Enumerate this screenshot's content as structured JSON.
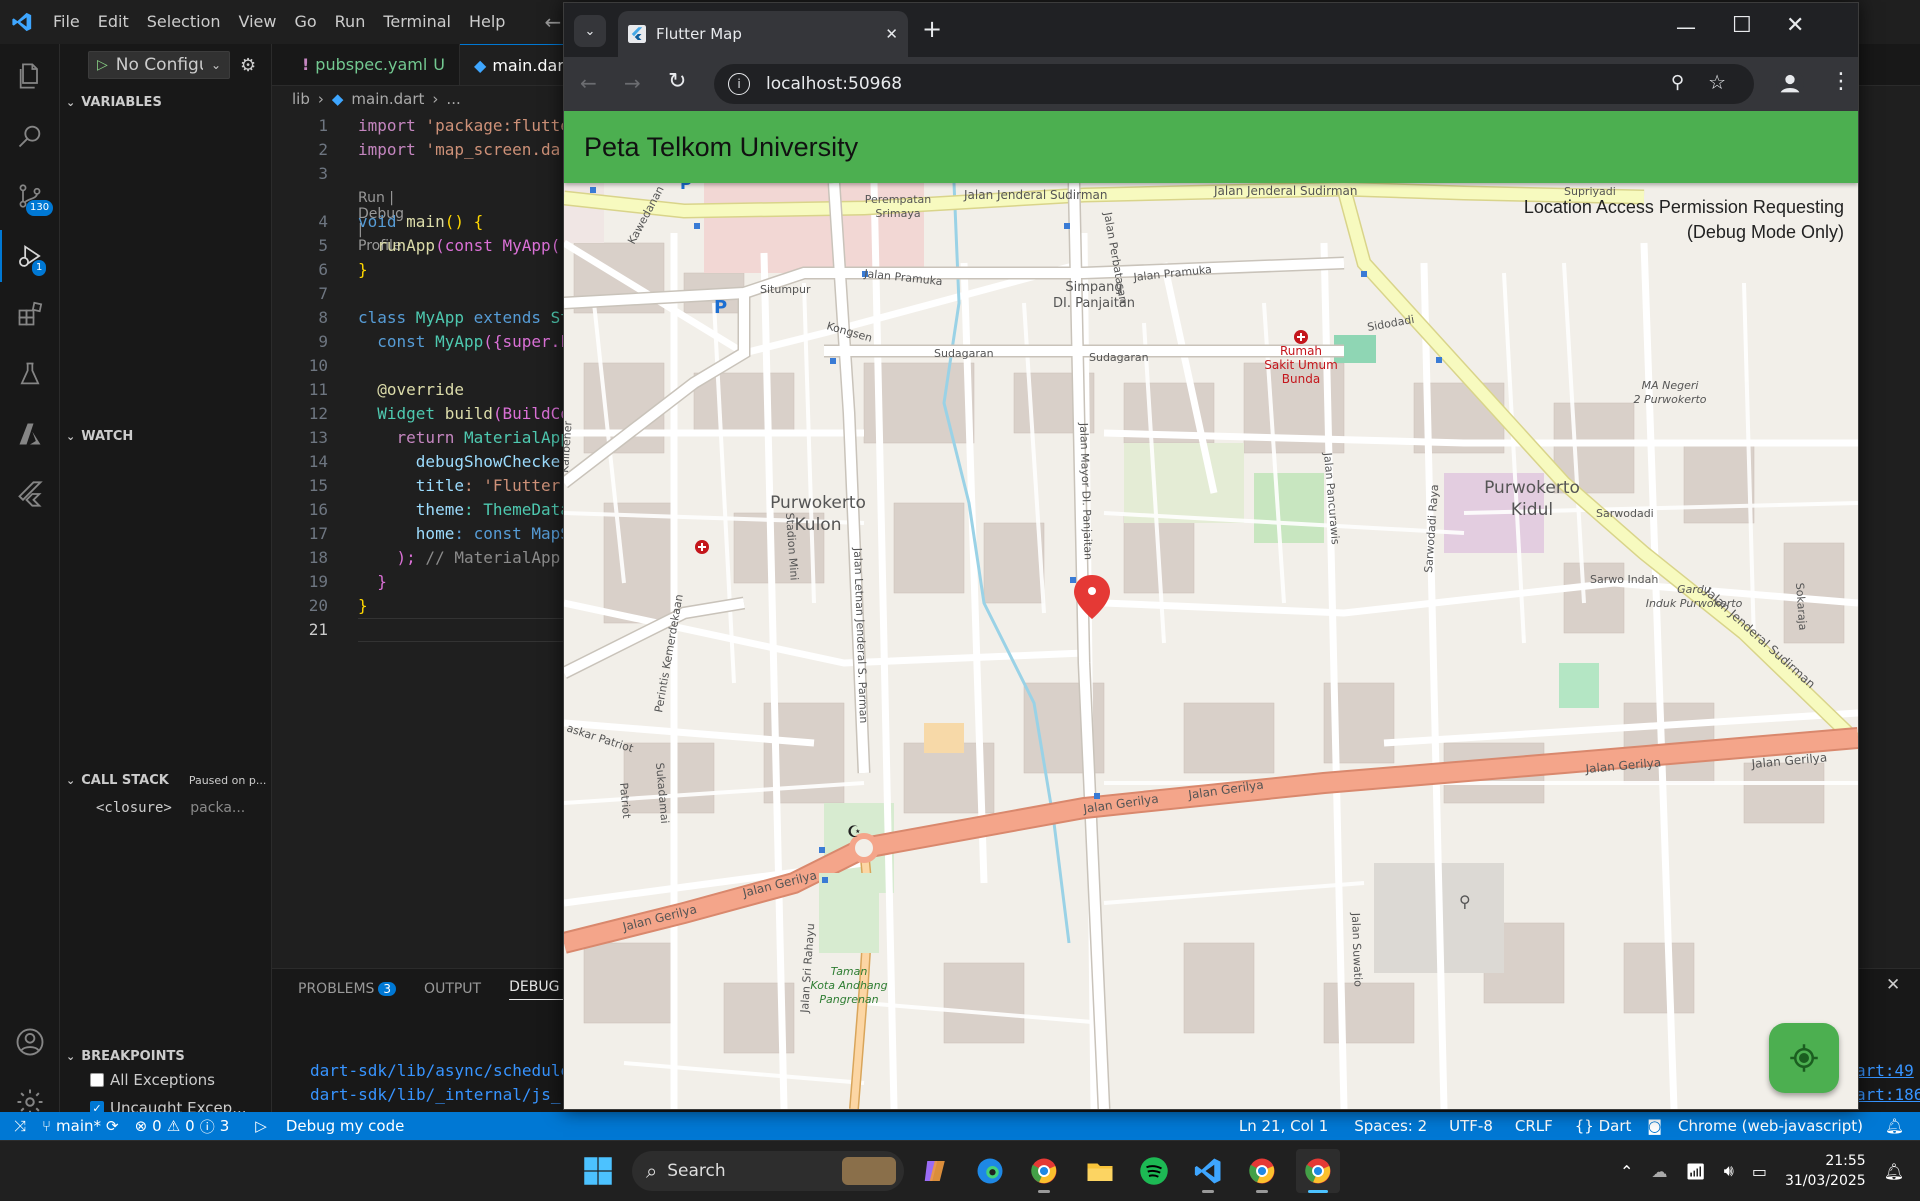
{
  "vscode": {
    "menu": [
      "File",
      "Edit",
      "Selection",
      "View",
      "Go",
      "Run",
      "Terminal",
      "Help"
    ],
    "activity_badges": {
      "source_control": "130",
      "run_debug": "1"
    },
    "run_config": "No Configu",
    "sections": {
      "variables": "VARIABLES",
      "watch": "WATCH",
      "call_stack": "CALL STACK",
      "call_stack_status": "Paused on p...",
      "breakpoints": "BREAKPOINTS"
    },
    "call_stack_frame": {
      "name": "<closure>",
      "source": "packa..."
    },
    "breakpoints": [
      {
        "label": "All Exceptions",
        "checked": false
      },
      {
        "label": "Uncaught Excep...",
        "checked": true
      }
    ],
    "tabs": [
      {
        "prefix": "!",
        "label": "pubspec.yaml",
        "suffix": "U"
      },
      {
        "prefix": "",
        "label": "main.dart",
        "suffix": ""
      }
    ],
    "breadcrumb": [
      "lib",
      "main.dart",
      "..."
    ],
    "codelens": "Run | Debug | Profile",
    "line_numbers": [
      "1",
      "2",
      "3",
      "4",
      "5",
      "6",
      "7",
      "8",
      "9",
      "10",
      "11",
      "12",
      "13",
      "14",
      "15",
      "16",
      "17",
      "18",
      "19",
      "20",
      "21"
    ],
    "code_text": {
      "l1_kw": "import",
      "l1_str": " 'package:flutte",
      "l2_kw": "import",
      "l2_str": " 'map_screen.dar",
      "l4_kw": "void",
      "l4_fn": " main",
      "l4_rest": "() {",
      "l5_fn": "runApp",
      "l5_rest": "(const MyApp(",
      "l6": "}",
      "l8_kw": "class",
      "l8_cls": " MyApp",
      "l8_kw2": " extends",
      "l8_rest": " St",
      "l9_kw": "const",
      "l9_cls": " MyApp",
      "l9_rest": "({super.k",
      "l11": "@override",
      "l12_cls": "Widget",
      "l12_fn": " build",
      "l12_rest": "(BuildCo",
      "l13_kw": "return",
      "l13_cls": " MaterialApp",
      "l14": "debugShowChecke",
      "l15_pr": "title",
      "l15_str": ": 'Flutter",
      "l16_pr": "theme",
      "l16_cls": ": ThemeData",
      "l17_pr": "home",
      "l17_rest": ": const MapS",
      "l18": ");",
      "l18_cmt": " // MaterialApp",
      "l19": "}",
      "l20": "}"
    },
    "panel_tabs": {
      "problems": "PROBLEMS",
      "problems_count": "3",
      "output": "OUTPUT",
      "debug_console": "DEBUG CO"
    },
    "debug_lines": [
      "dart-sdk/lib/async/schedule",
      "dart-sdk/lib/_internal/js_"
    ],
    "debug_right": [
      "art:49",
      "art:186"
    ],
    "status": {
      "branch": "main*",
      "errors": "0",
      "warnings": "0",
      "infos": "3",
      "debug": "Debug my code",
      "cursor": "Ln 21, Col 1",
      "spaces": "Spaces: 2",
      "encoding": "UTF-8",
      "eol": "CRLF",
      "language": "{} Dart",
      "target": "Chrome (web-javascript)"
    }
  },
  "chrome": {
    "tab_title": "Flutter Map",
    "url": "localhost:50968",
    "app_title": "Peta Telkom University",
    "notice": [
      "Location Access Permission Requesting",
      "(Debug Mode Only)"
    ]
  },
  "map_labels": {
    "purwokerto_kulon": [
      "Purwokerto",
      "Kulon"
    ],
    "purwokerto_kidul": [
      "Purwokerto",
      "Kidul"
    ],
    "sudirman1": "Jalan Jenderal Sudirman",
    "sudirman2": "Jalan Jenderal Sudirman",
    "sudirman3": "Jalan Jenderal Sudirman",
    "pramuka1": "Jalan Pramuka",
    "pramuka2": "Jalan Pramuka",
    "gerilya1": "Jalan Gerilya",
    "gerilya2": "Jalan Gerilya",
    "gerilya3": "Jalan Gerilya",
    "gerilya4": "Jalan Gerilya",
    "gerilya5": "Jalan Gerilya",
    "gerilya6": "Jalan Gerilya",
    "simpang": [
      "Simpang",
      "DI. Panjaitan"
    ],
    "perempatan": [
      "Perempatan",
      "Srimaya"
    ],
    "rumah_sakit": [
      "Rumah",
      "Sakit Umum",
      "Bunda"
    ],
    "ma_negeri": [
      "MA Negeri",
      "2 Purwokerto"
    ],
    "gardu": [
      "Gardu",
      "Induk Purwokerto"
    ],
    "taman": [
      "Taman",
      "Kota Andhang",
      "Pangrenan"
    ],
    "sudagaran1": "Sudagaran",
    "sudagaran2": "Sudagaran",
    "kongsen": "Kongsen",
    "situmpur": "Situmpur",
    "sidodadi": "Sidodadi",
    "sarwodadi": "Sarwodadi",
    "sarwo_indah": "Sarwo Indah",
    "supriyadi": "Supriyadi",
    "kawedanan": "Kawedanan",
    "letnan": "Jalan Letnan Jenderal S. Parman",
    "mayor": "Jalan Mayor DI. Panjaitan",
    "perintis": "Perintis Kemerdekaan",
    "pancurawis": "Jalan Pancurawis",
    "stadion": "Stadion Mini",
    "sukadamai": "Sukadamai",
    "patriot": "Patriot",
    "baskar": "askar Patriot",
    "suwatio": "Jalan Suwatio",
    "rahayu": "Jalan Sri Rahayu",
    "sarwodadi_raya": "Sarwodadi Raya",
    "sokaraja": "Sokaraja",
    "perbatasan": "Jalan Perbatasan",
    "kalibener": "Kalibener"
  },
  "taskbar": {
    "search": "Search",
    "time": "21:55",
    "date": "31/03/2025"
  },
  "colors": {
    "vscode_accent": "#0078d4",
    "appbar": "#4caf50",
    "primary_road": "#f4a58a",
    "secondary_road": "#f7fabf",
    "map_bg": "#f2efe9",
    "marker": "#e53935"
  }
}
